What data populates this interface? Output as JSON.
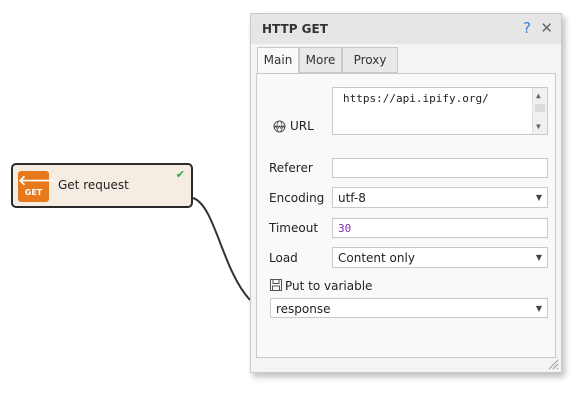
{
  "node": {
    "icon_arrow": "🡐",
    "icon_label": "GET",
    "title": "Get request",
    "status_icon": "check-icon",
    "accent": "#e8791b"
  },
  "panel": {
    "title": "HTTP GET",
    "help": "?",
    "close": "✕",
    "tabs": [
      "Main",
      "More",
      "Proxy"
    ],
    "active_tab": "Main"
  },
  "form": {
    "url_label": "URL",
    "url_value": "https://api.ipify.org/",
    "referer_label": "Referer",
    "referer_value": "",
    "encoding_label": "Encoding",
    "encoding_value": "utf-8",
    "timeout_label": "Timeout",
    "timeout_value": "30",
    "load_label": "Load",
    "load_value": "Content only",
    "put_label": "Put to variable",
    "variable_value": "response"
  }
}
